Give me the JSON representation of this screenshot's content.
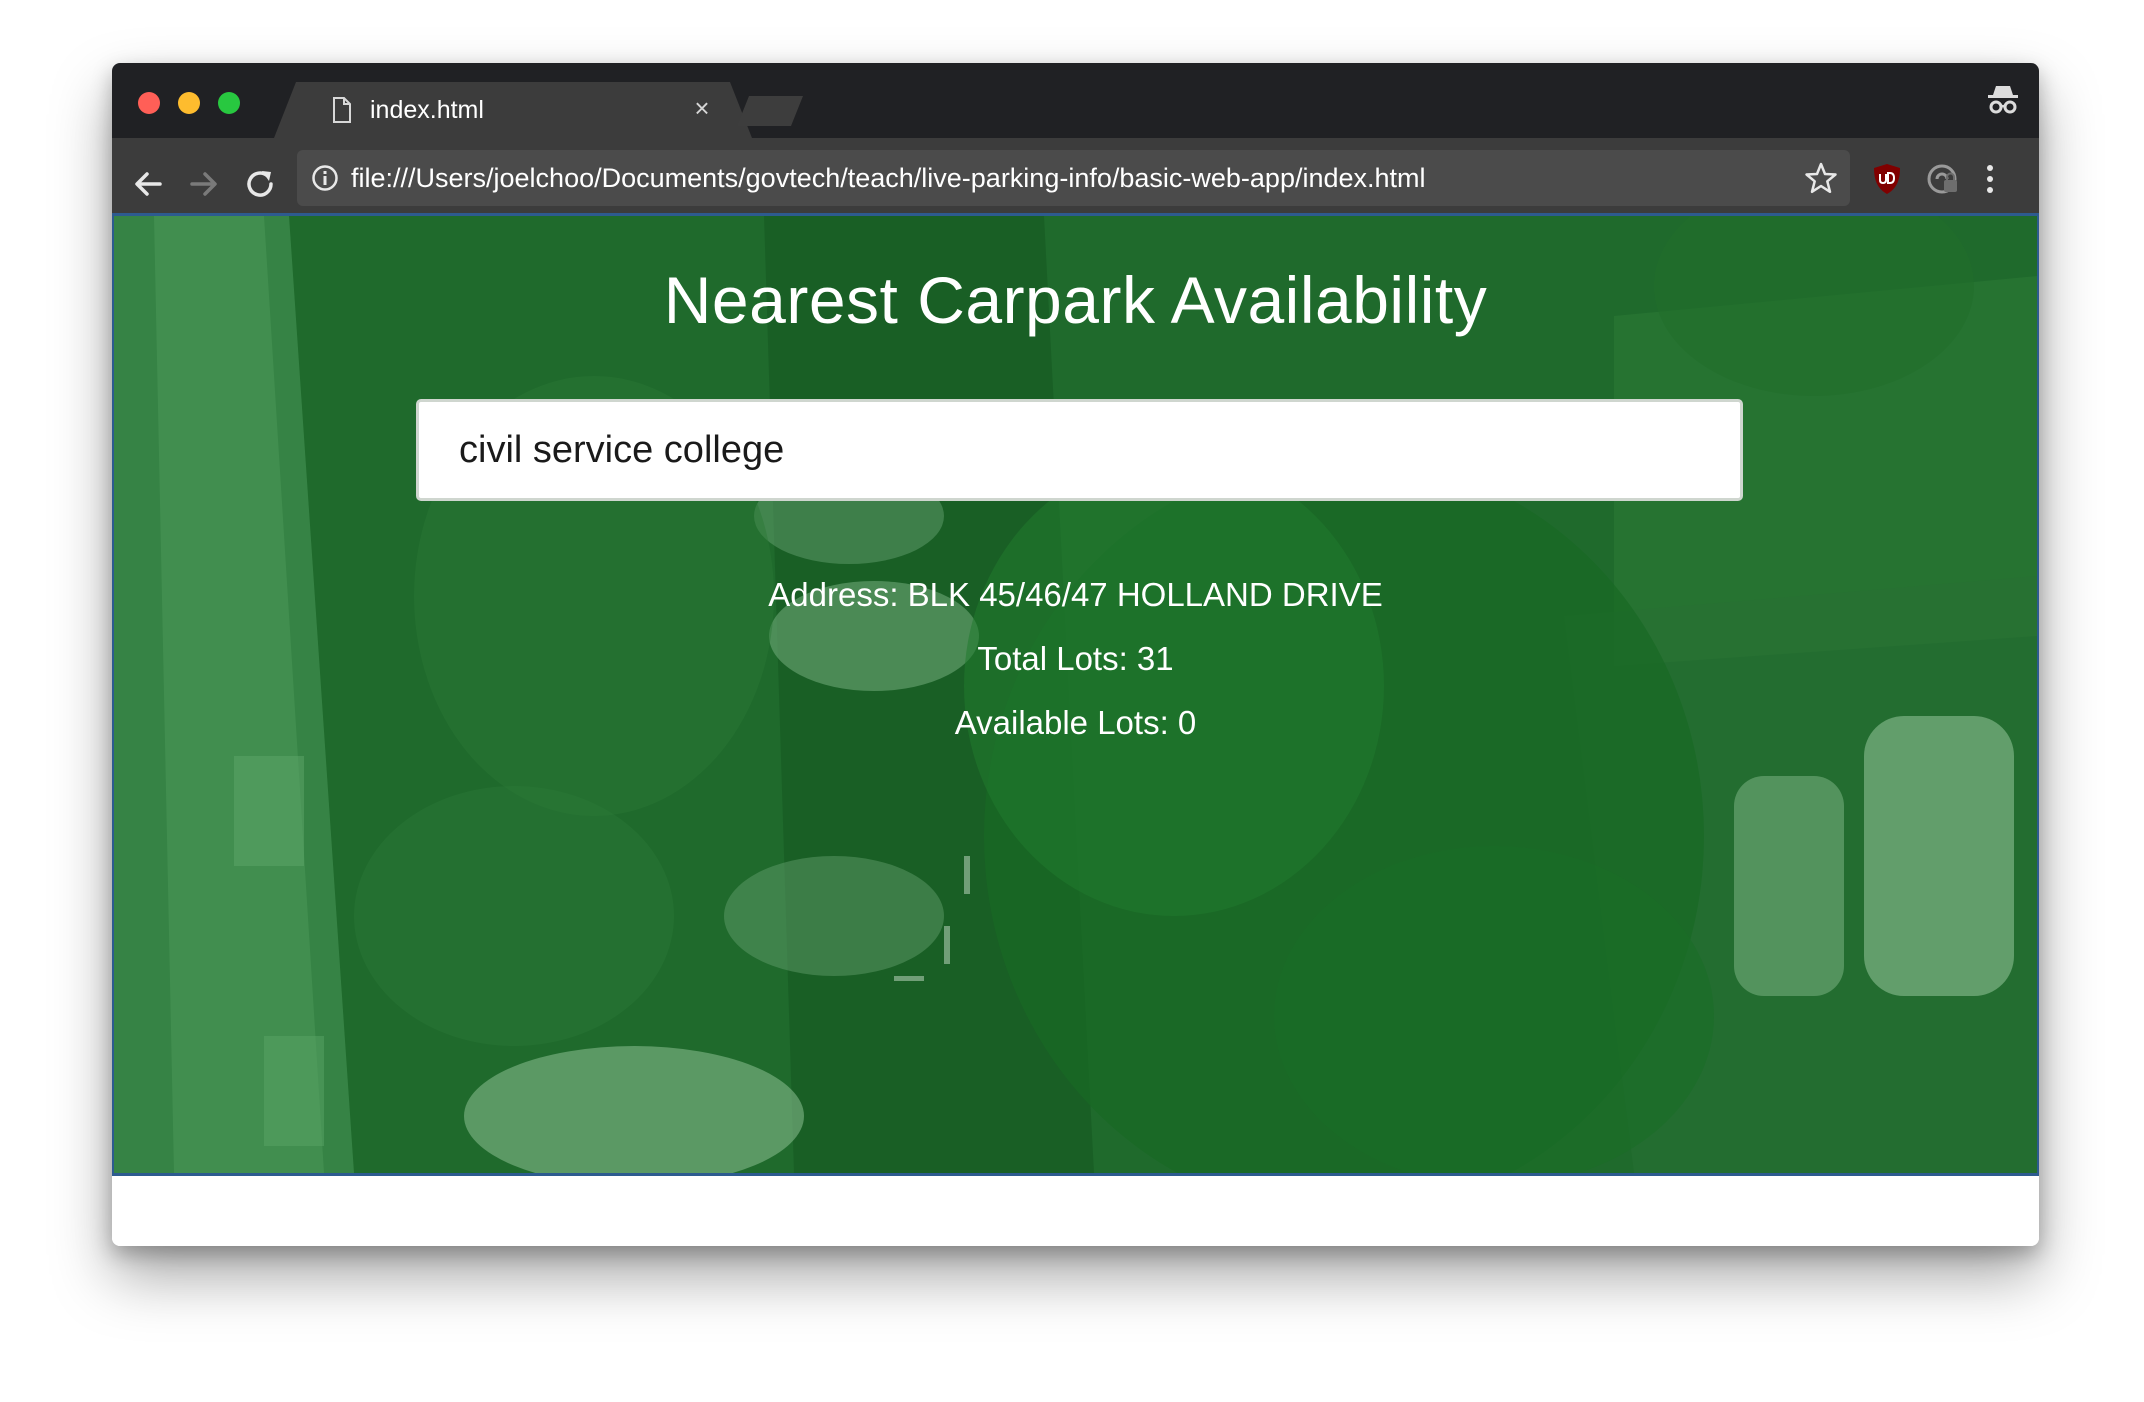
{
  "browser": {
    "tab_title": "index.html",
    "tab_close": "×",
    "url": "file:///Users/joelchoo/Documents/govtech/teach/live-parking-info/basic-web-app/index.html",
    "icons": {
      "back": "arrow-left",
      "forward": "arrow-right",
      "reload": "reload",
      "info": "info-circle",
      "bookmark": "star-outline",
      "extension1": "ublock-origin-shield",
      "extension2": "lock-shield",
      "menu": "three-dots-vertical",
      "incognito": "incognito-spy"
    },
    "colors": {
      "traffic_red": "#ff5f57",
      "traffic_yellow": "#febc2e",
      "traffic_green": "#28c840",
      "chrome_dark": "#202124",
      "toolbar": "#3c3c3c"
    }
  },
  "page": {
    "title": "Nearest Carpark Availability",
    "search": {
      "value": "civil service college"
    },
    "result": {
      "address": "Address: BLK 45/46/47 HOLLAND DRIVE",
      "total_lots": "Total Lots: 31",
      "available_lots": "Available Lots: 0"
    },
    "colors": {
      "overlay": "#1f6a2c",
      "text": "#ffffff"
    }
  }
}
